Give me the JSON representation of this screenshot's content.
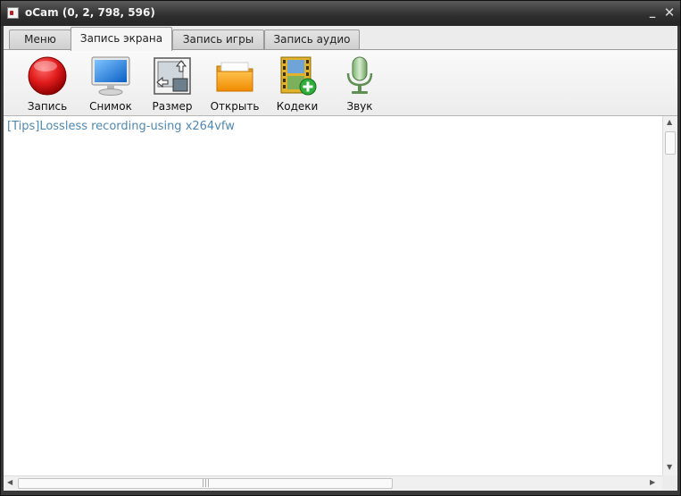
{
  "window": {
    "title": "oCam (0, 2, 798, 596)",
    "minimize_glyph": "_",
    "close_glyph": "✕"
  },
  "tabs": [
    {
      "label": "Меню",
      "active": false
    },
    {
      "label": "Запись экрана",
      "active": true
    },
    {
      "label": "Запись игры",
      "active": false
    },
    {
      "label": "Запись аудио",
      "active": false
    }
  ],
  "toolbar": [
    {
      "label": "Запись",
      "icon": "record-icon"
    },
    {
      "label": "Снимок",
      "icon": "monitor-icon"
    },
    {
      "label": "Размер",
      "icon": "resize-icon"
    },
    {
      "label": "Открыть",
      "icon": "folder-icon"
    },
    {
      "label": "Кодеки",
      "icon": "film-add-icon"
    },
    {
      "label": "Звук",
      "icon": "microphone-icon"
    }
  ],
  "content": {
    "tip": "[Tips]Lossless recording-using x264vfw"
  },
  "colors": {
    "tip_text": "#4f88b3",
    "record_red": "#d9141a",
    "titlebar": "#2e2e2e"
  }
}
